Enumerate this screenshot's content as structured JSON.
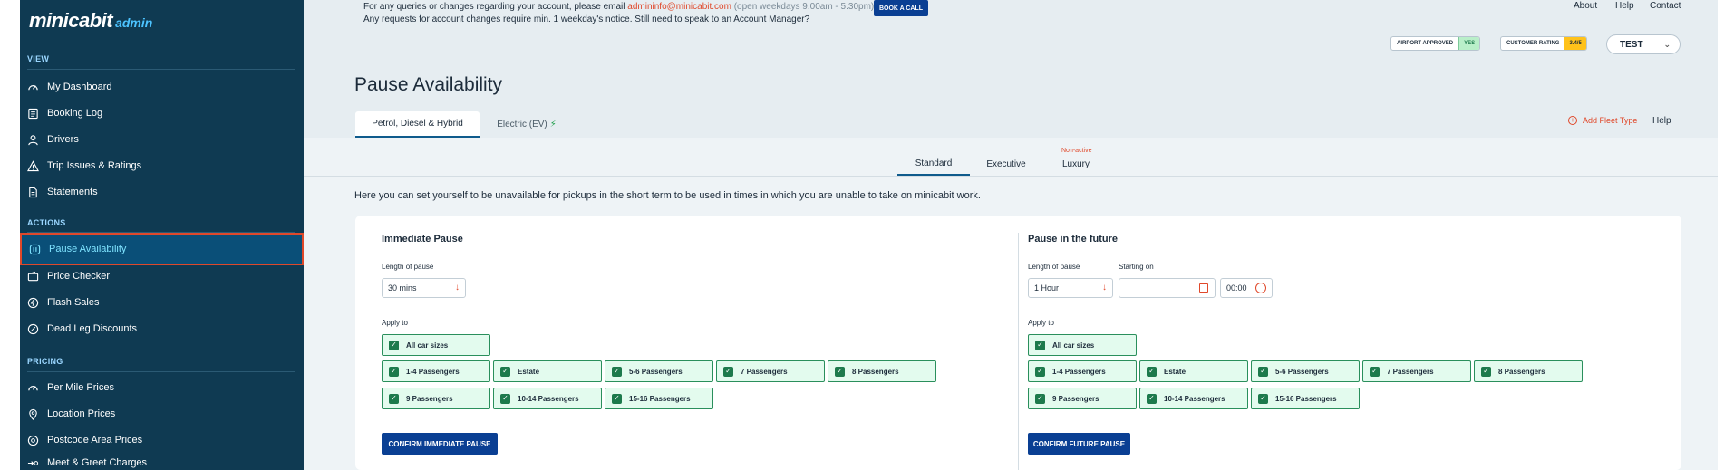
{
  "sidebar": {
    "logo": {
      "brand": "minicabit",
      "suffix": "admin"
    },
    "sections": {
      "view": "VIEW",
      "actions": "ACTIONS",
      "pricing": "PRICING"
    },
    "items": [
      {
        "label": "My Dashboard",
        "icon": "gauge-icon"
      },
      {
        "label": "Booking Log",
        "icon": "log-icon"
      },
      {
        "label": "Drivers",
        "icon": "user-icon"
      },
      {
        "label": "Trip Issues & Ratings",
        "icon": "warning-icon"
      },
      {
        "label": "Statements",
        "icon": "document-icon"
      },
      {
        "label": "Pause Availability",
        "icon": "pause-icon",
        "active": true
      },
      {
        "label": "Price Checker",
        "icon": "wallet-icon"
      },
      {
        "label": "Flash Sales",
        "icon": "flash-icon"
      },
      {
        "label": "Dead Leg Discounts",
        "icon": "discount-icon"
      },
      {
        "label": "Per Mile Prices",
        "icon": "gauge-icon"
      },
      {
        "label": "Location Prices",
        "icon": "pin-icon"
      },
      {
        "label": "Postcode Area Prices",
        "icon": "target-icon"
      },
      {
        "label": "Meet & Greet Charges",
        "icon": "meet-icon"
      }
    ]
  },
  "header": {
    "notice_line1_prefix": "For any queries or changes regarding your account, please email ",
    "notice_email": "admininfo@minicabit.com",
    "notice_hours": " (open weekdays 9.00am - 5.30pm)",
    "notice_line2": "Any requests for account changes require min. 1 weekday's notice. Still need to speak to an Account Manager?",
    "book_call": "BOOK A CALL",
    "links": {
      "about": "About",
      "help": "Help",
      "contact": "Contact"
    },
    "airport_badge": {
      "label": "AIRPORT APPROVED",
      "value": "YES"
    },
    "rating_badge": {
      "label": "CUSTOMER RATING",
      "value": "3.4/5"
    },
    "account_select": "TEST"
  },
  "page": {
    "title": "Pause Availability",
    "tabs": [
      {
        "label": "Petrol, Diesel & Hybrid",
        "active": true
      },
      {
        "label": "Electric (EV)",
        "icon": "flash-icon"
      }
    ],
    "add_fleet": "Add Fleet Type",
    "help": "Help",
    "subtabs": [
      {
        "label": "Standard",
        "active": true
      },
      {
        "label": "Executive"
      },
      {
        "label": "Luxury",
        "note": "Non-active"
      }
    ],
    "intro": "Here you can set yourself to be unavailable for pickups in the short term to be used in times in which you are unable to take on minicabit work."
  },
  "immediate": {
    "title": "Immediate Pause",
    "length_label": "Length of pause",
    "length_value": "30 mins",
    "apply_label": "Apply to",
    "all_sizes": "All car sizes",
    "options": [
      "1-4 Passengers",
      "Estate",
      "5-6 Passengers",
      "7 Passengers",
      "8 Passengers",
      "9 Passengers",
      "10-14 Passengers",
      "15-16 Passengers"
    ],
    "confirm": "CONFIRM IMMEDIATE PAUSE"
  },
  "future": {
    "title": "Pause in the future",
    "length_label": "Length of pause",
    "length_value": "1 Hour",
    "starting_label": "Starting on",
    "date_value": "",
    "time_value": "00:00",
    "apply_label": "Apply to",
    "all_sizes": "All car sizes",
    "options": [
      "1-4 Passengers",
      "Estate",
      "5-6 Passengers",
      "7 Passengers",
      "8 Passengers",
      "9 Passengers",
      "10-14 Passengers",
      "15-16 Passengers"
    ],
    "confirm": "CONFIRM FUTURE PAUSE"
  },
  "colors": {
    "sidebar": "#0f3a52",
    "accent": "#e0482a",
    "primary_button": "#0a3f93",
    "check_green": "#1d7a4c"
  }
}
